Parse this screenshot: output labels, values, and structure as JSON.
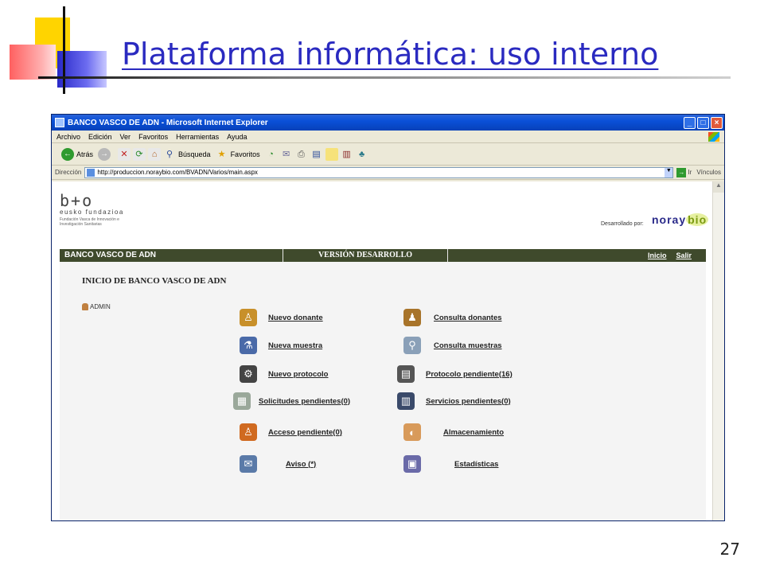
{
  "slide": {
    "title": "Plataforma informática: uso interno",
    "number": "27"
  },
  "browser": {
    "window_title": "BANCO VASCO DE ADN - Microsoft Internet Explorer",
    "menu": [
      "Archivo",
      "Edición",
      "Ver",
      "Favoritos",
      "Herramientas",
      "Ayuda"
    ],
    "toolbar": {
      "back": "Atrás",
      "search": "Búsqueda",
      "favorites": "Favoritos"
    },
    "address": {
      "label": "Dirección",
      "url": "http://produccion.noraybio.com/BVADN/Varios/main.aspx",
      "go": "Ir",
      "links": "Vínculos"
    }
  },
  "app": {
    "logo": {
      "mark": "b+o",
      "name": "eusko fundazioa",
      "subtitle": "Fundación Vasca de Innovación e Investigación Sanitarias"
    },
    "developed_by": "Desarrollado por:",
    "partner_logo": {
      "part1": "noray",
      "part2": "bio"
    },
    "nav": {
      "left": "BANCO VASCO DE ADN",
      "middle": "VERSIÓN DESARROLLO",
      "inicio": "Inicio",
      "salir": "Salir"
    },
    "heading": "INICIO DE BANCO VASCO DE ADN",
    "user": "ADMIN",
    "menu_left": [
      {
        "label": "Nuevo donante",
        "icon": "person-icon",
        "color": "#c8902a"
      },
      {
        "label": "Nueva muestra",
        "icon": "test-tube-icon",
        "color": "#4a6aa8"
      },
      {
        "label": "Nuevo protocolo",
        "icon": "gear-icon",
        "color": "#444444"
      },
      {
        "label": "Solicitudes pendientes(0)",
        "icon": "form-icon",
        "color": "#9aa89a"
      },
      {
        "label": "Acceso pendiente(0)",
        "icon": "user-icon",
        "color": "#d06a20"
      },
      {
        "label": "Aviso (*)",
        "icon": "envelope-icon",
        "color": "#5a7aa8"
      }
    ],
    "menu_right": [
      {
        "label": "Consulta donantes",
        "icon": "people-icon",
        "color": "#a8742a"
      },
      {
        "label": "Consulta muestras",
        "icon": "magnifier-icon",
        "color": "#8aa0b8"
      },
      {
        "label": "Protocolo pendiente(16)",
        "icon": "documents-icon",
        "color": "#555555"
      },
      {
        "label": "Servicios pendientes(0)",
        "icon": "files-icon",
        "color": "#3a4a6a"
      },
      {
        "label": "Almacenamiento",
        "icon": "storage-icon",
        "color": "#d89a5a"
      },
      {
        "label": "Estadísticas",
        "icon": "chart-icon",
        "color": "#6a6aa8"
      }
    ]
  }
}
